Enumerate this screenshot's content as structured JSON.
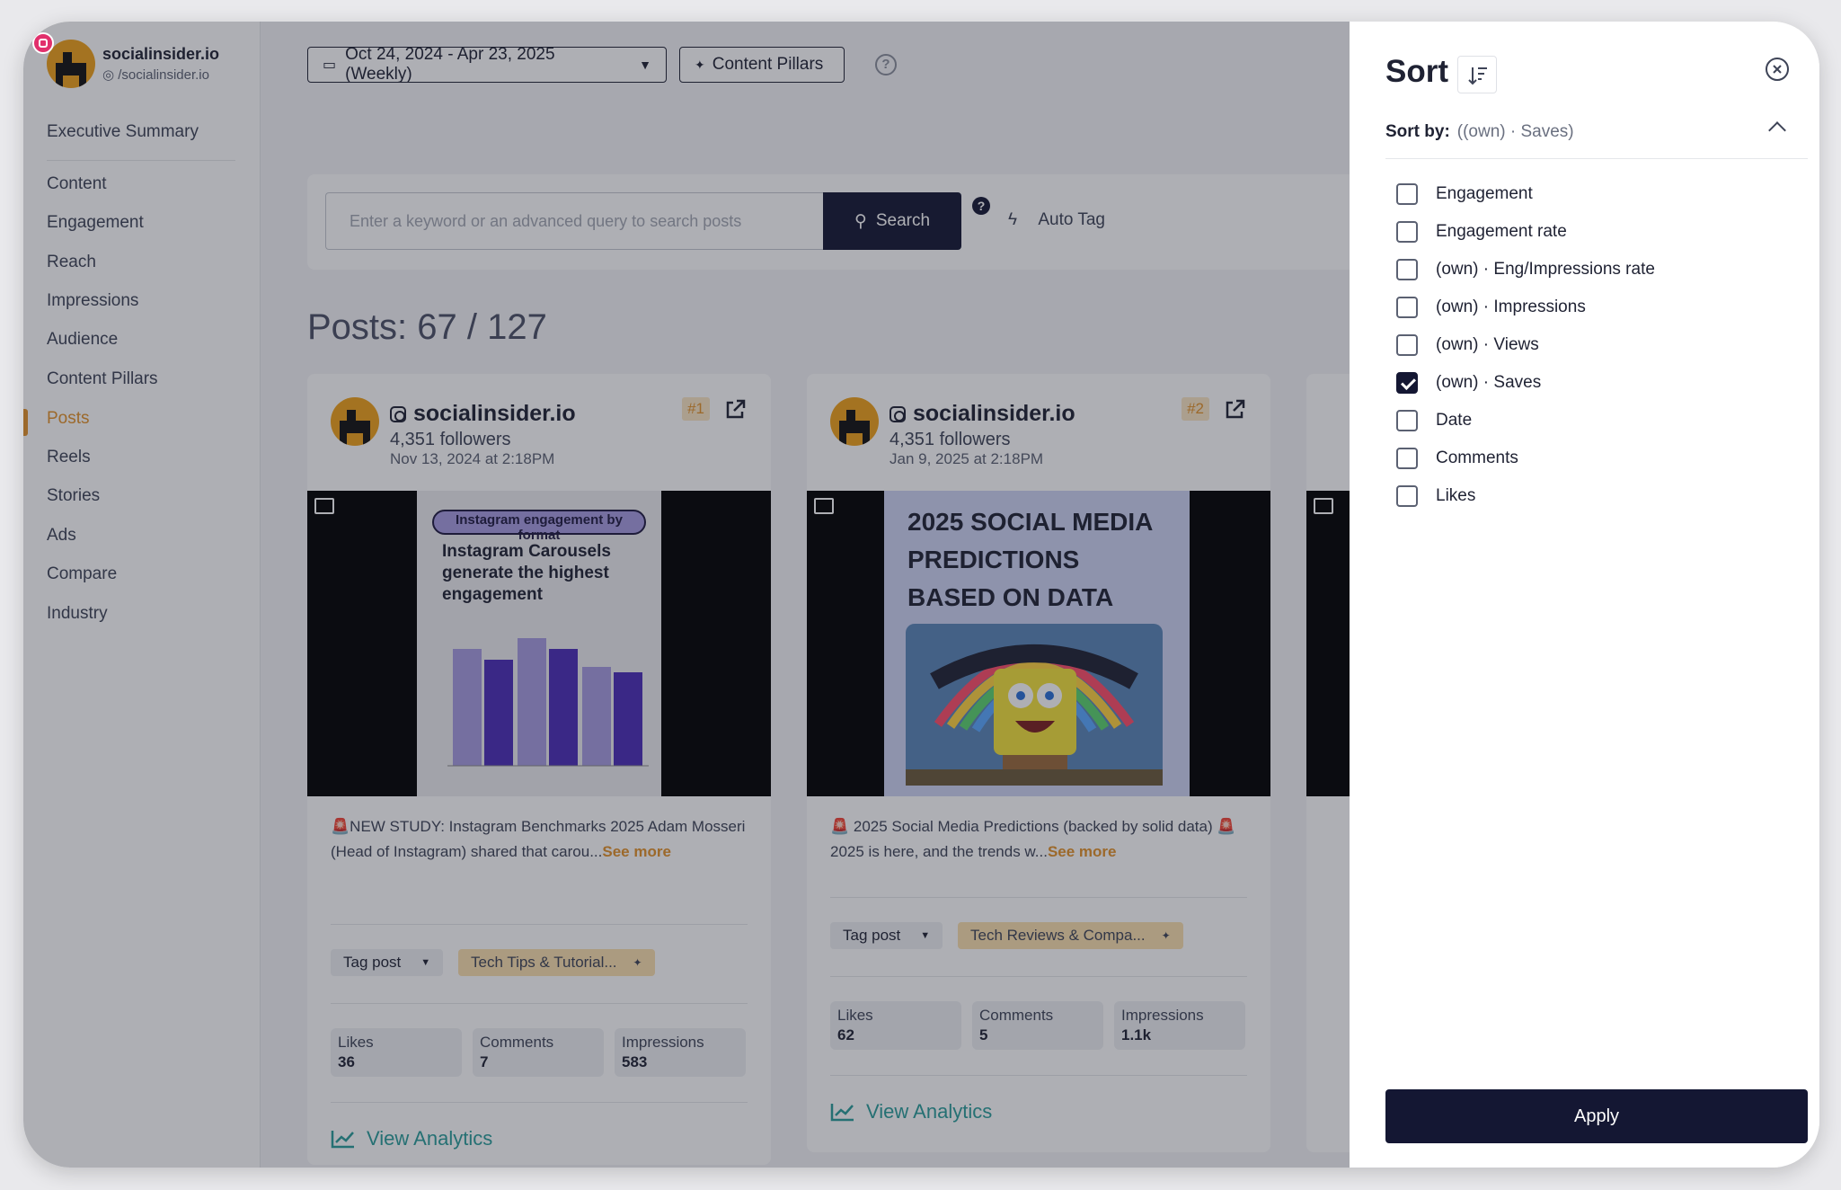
{
  "sidebar": {
    "brand_name": "socialinsider.io",
    "brand_handle": "/socialinsider.io",
    "items": [
      {
        "label": "Executive Summary"
      },
      {
        "label": "Content"
      },
      {
        "label": "Engagement"
      },
      {
        "label": "Reach"
      },
      {
        "label": "Impressions"
      },
      {
        "label": "Audience"
      },
      {
        "label": "Content Pillars"
      },
      {
        "label": "Posts"
      },
      {
        "label": "Reels"
      },
      {
        "label": "Stories"
      },
      {
        "label": "Ads"
      },
      {
        "label": "Compare"
      },
      {
        "label": "Industry"
      }
    ],
    "active_item": "Posts"
  },
  "toolbar": {
    "date_range": "Oct 24, 2024 - Apr 23, 2025 (Weekly)",
    "content_pillars": "Content Pillars"
  },
  "search": {
    "placeholder": "Enter a keyword or an advanced query to search posts",
    "button_label": "Search",
    "help": "?",
    "auto_tag": "Auto Tag"
  },
  "posts_count": "Posts: 67 / 127",
  "posts": [
    {
      "account": "socialinsider.io",
      "followers": "4,351 followers",
      "date": "Nov 13, 2024 at 2:18PM",
      "rank": "#1",
      "media_heading": "Instagram engagement by format",
      "media_title": "Instagram Carousels generate the highest engagement",
      "text": "🚨NEW STUDY: Instagram Benchmarks 2025 Adam Mosseri (Head of Instagram) shared that carou...",
      "see_more": "See more",
      "tag_label": "Tag post",
      "pillar": "Tech Tips & Tutorial...",
      "stats": [
        {
          "label": "Likes",
          "value": "36"
        },
        {
          "label": "Comments",
          "value": "7"
        },
        {
          "label": "Impressions",
          "value": "583"
        }
      ],
      "view_analytics": "View Analytics"
    },
    {
      "account": "socialinsider.io",
      "followers": "4,351 followers",
      "date": "Jan 9, 2025 at 2:18PM",
      "rank": "#2",
      "media_title": "2025 SOCIAL MEDIA PREDICTIONS BASED ON DATA",
      "text": "🚨 2025 Social Media Predictions (backed by solid data) 🚨 2025 is here, and the trends w...",
      "see_more": "See more",
      "tag_label": "Tag post",
      "pillar": "Tech Reviews & Compa...",
      "stats": [
        {
          "label": "Likes",
          "value": "62"
        },
        {
          "label": "Comments",
          "value": "5"
        },
        {
          "label": "Impressions",
          "value": "1.1k"
        }
      ],
      "view_analytics": "View Analytics"
    }
  ],
  "sort_panel": {
    "title": "Sort",
    "sort_by_label": "Sort by:",
    "sort_by_value": "((own) · Saves)",
    "options": [
      {
        "label": "Engagement",
        "checked": false
      },
      {
        "label": "Engagement rate",
        "checked": false
      },
      {
        "label": "(own) · Eng/Impressions rate",
        "checked": false
      },
      {
        "label": "(own) · Impressions",
        "checked": false
      },
      {
        "label": "(own) · Views",
        "checked": false
      },
      {
        "label": "(own) · Saves",
        "checked": true
      },
      {
        "label": "Date",
        "checked": false
      },
      {
        "label": "Comments",
        "checked": false
      },
      {
        "label": "Likes",
        "checked": false
      }
    ],
    "apply_label": "Apply"
  },
  "colors": {
    "accent": "#e3922a",
    "primary_dark": "#141733",
    "analytics_teal": "#2a9d9a"
  }
}
